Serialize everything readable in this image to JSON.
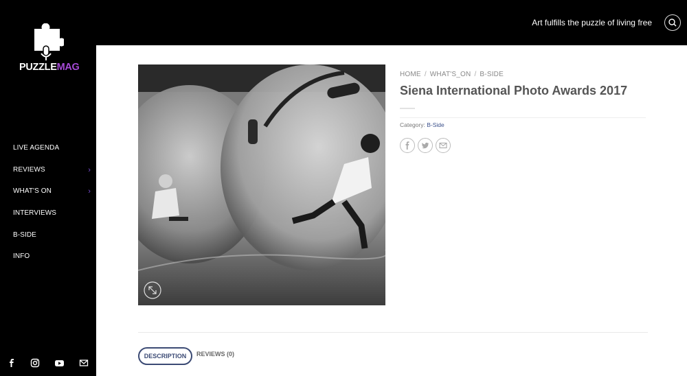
{
  "sidebar": {
    "logo": {
      "word_white": "PUZZLE",
      "word_purple": "MAG"
    },
    "nav": [
      {
        "label": "LIVE AGENDA",
        "has_submenu": false
      },
      {
        "label": "REVIEWS",
        "has_submenu": true
      },
      {
        "label": "WHAT'S ON",
        "has_submenu": true
      },
      {
        "label": "INTERVIEWS",
        "has_submenu": false
      },
      {
        "label": "B-SIDE",
        "has_submenu": false
      },
      {
        "label": "INFO",
        "has_submenu": false
      }
    ],
    "social": [
      "facebook-icon",
      "instagram-icon",
      "youtube-icon",
      "mail-icon"
    ]
  },
  "header": {
    "tagline": "Art fulfills the puzzle of living free",
    "search_icon": "search-icon"
  },
  "product": {
    "breadcrumb": [
      "HOME",
      "WHAT'S_ON",
      "B-SIDE"
    ],
    "title": "Siena International Photo Awards 2017",
    "category_label": "Category:",
    "category_value": "B-Side",
    "share": [
      "facebook-icon",
      "twitter-icon",
      "mail-icon"
    ]
  },
  "tabs": {
    "description": "DESCRIPTION",
    "reviews": "REVIEWS (0)"
  },
  "colors": {
    "accent_purple": "#a64ad6",
    "link_blue": "#3a4f8a",
    "tab_navy": "#3b4a74"
  }
}
